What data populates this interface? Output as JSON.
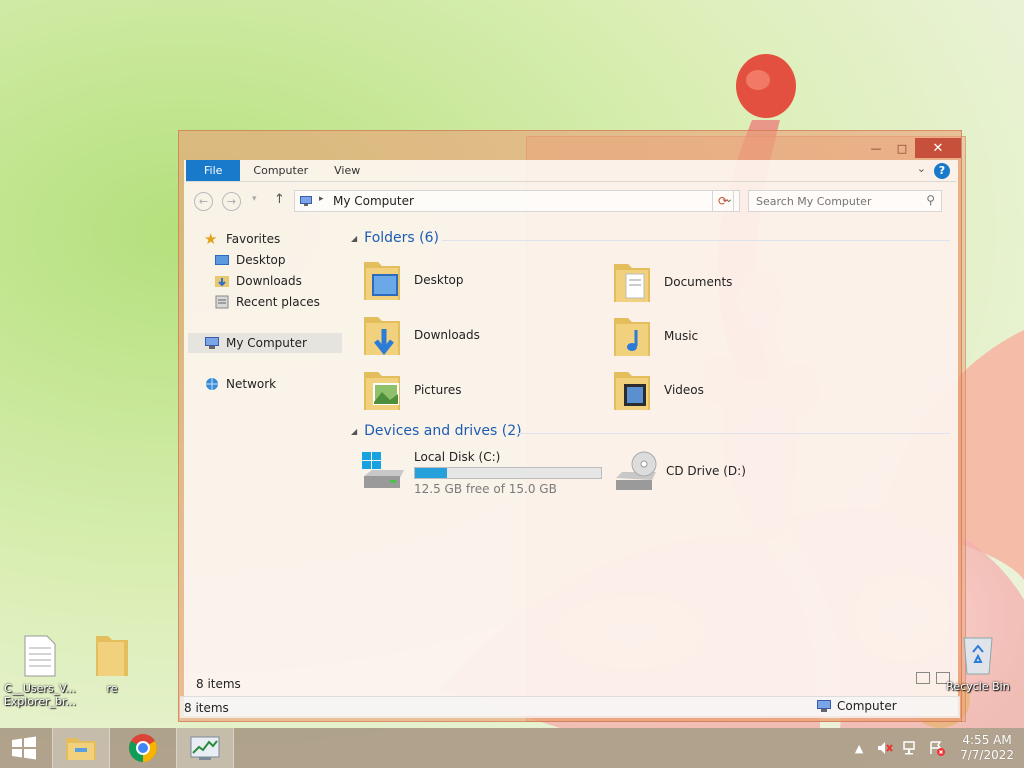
{
  "window": {
    "tabs": [
      "File",
      "Computer",
      "View"
    ],
    "help_label": "?",
    "address_path": "My Computer",
    "search_placeholder": "Search My Computer"
  },
  "navpane": {
    "favorites": "Favorites",
    "desktop": "Desktop",
    "downloads": "Downloads",
    "recent": "Recent places",
    "my_computer": "My Computer",
    "network": "Network"
  },
  "content": {
    "folders_header": "Folders (6)",
    "folders": [
      {
        "label": "Desktop",
        "icon": "folder-desktop-icon"
      },
      {
        "label": "Documents",
        "icon": "folder-documents-icon"
      },
      {
        "label": "Downloads",
        "icon": "folder-downloads-icon"
      },
      {
        "label": "Music",
        "icon": "folder-music-icon"
      },
      {
        "label": "Pictures",
        "icon": "folder-pictures-icon"
      },
      {
        "label": "Videos",
        "icon": "folder-videos-icon"
      }
    ],
    "devices_header": "Devices and drives (2)",
    "drives": [
      {
        "label": "Local Disk (C:)",
        "free_text": "12.5 GB free of 15.0 GB",
        "used_fraction": 0.17
      },
      {
        "label": "CD Drive (D:)"
      }
    ]
  },
  "status": {
    "items_count": "8 items",
    "items_count_back": "8 items",
    "computer_label": "Computer"
  },
  "desktop_icons": {
    "file_label": "C__Users_V... Explorer_br...",
    "folder_label": "re",
    "recycle_label": "Recycle Bin"
  },
  "taskbar": {
    "time": "4:55 AM",
    "date": "7/7/2022"
  },
  "colors": {
    "accent_blue": "#1979ca",
    "group_header": "#1e5cb4",
    "drive_fill": "#26a0da",
    "window_frame": "#eca078",
    "close_button": "#c7503b"
  }
}
